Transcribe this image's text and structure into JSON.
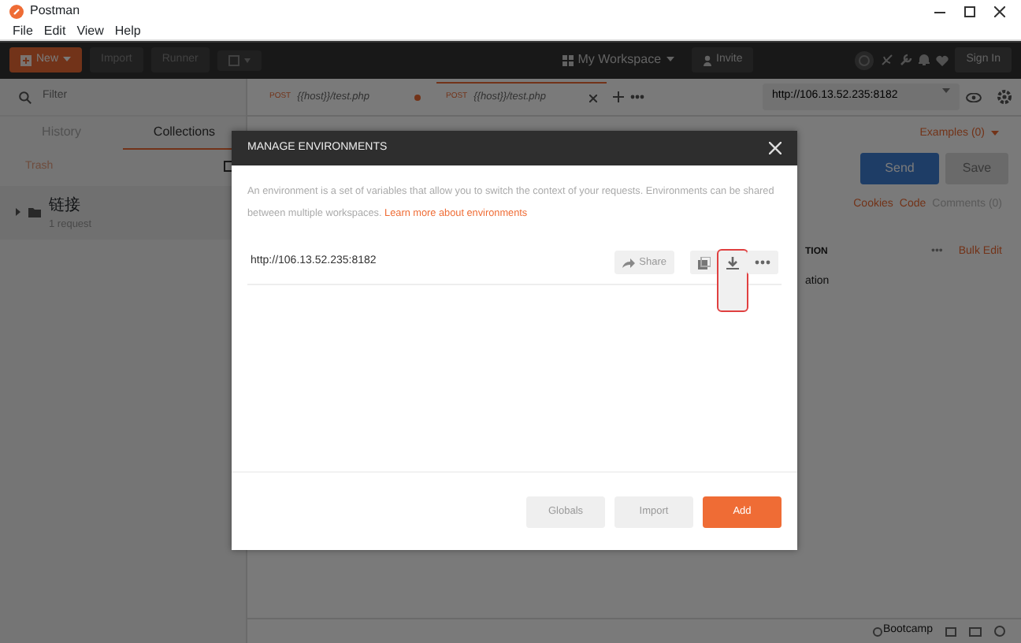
{
  "window": {
    "title": "Postman",
    "menu": [
      "File",
      "Edit",
      "View",
      "Help"
    ]
  },
  "toolbar": {
    "new_label": "New",
    "buttons": [
      "Import",
      "Runner"
    ],
    "workspace": "My Workspace",
    "invite": "Invite",
    "sign_in": "Sign In"
  },
  "sidebar": {
    "filter_placeholder": "Filter",
    "tabs": [
      {
        "label": "History",
        "selected": false
      },
      {
        "label": "Collections",
        "selected": true
      }
    ],
    "trash": "Trash",
    "collections": [
      {
        "name": "链接",
        "count": "1 request"
      }
    ]
  },
  "request_tabs": [
    {
      "method": "POST",
      "url": "{{host}}/test.php",
      "selected": false,
      "unsaved": true
    },
    {
      "method": "POST",
      "url": "{{host}}/test.php",
      "selected": true,
      "unsaved": false
    }
  ],
  "environment_select": "http://106.13.52.235:8182",
  "request": {
    "examples": "Examples (0)",
    "send": "Send",
    "save": "Save",
    "links": [
      "Cookies",
      "Code",
      "Comments (0)"
    ],
    "more": "•••",
    "bulk_edit": "Bulk Edit",
    "column_header": "TION",
    "column_cell": "ation"
  },
  "status_bar": {
    "bootcamp": "Bootcamp"
  },
  "dialog": {
    "title": "MANAGE ENVIRONMENTS",
    "intro": "An environment is a set of variables that allow you to switch the context of your requests. Environments can be shared between multiple workspaces.",
    "learn_more": "Learn more about environments",
    "environments": [
      {
        "name": "http://106.13.52.235:8182",
        "share": "Share",
        "actions": [
          {
            "kind": "duplicate",
            "highlighted": false
          },
          {
            "kind": "download",
            "highlighted": true
          },
          {
            "kind": "more",
            "highlighted": false
          }
        ]
      }
    ],
    "buttons": [
      {
        "label": "Globals",
        "kind": "secondary"
      },
      {
        "label": "Import",
        "kind": "secondary"
      },
      {
        "label": "Add",
        "kind": "primary"
      }
    ]
  }
}
